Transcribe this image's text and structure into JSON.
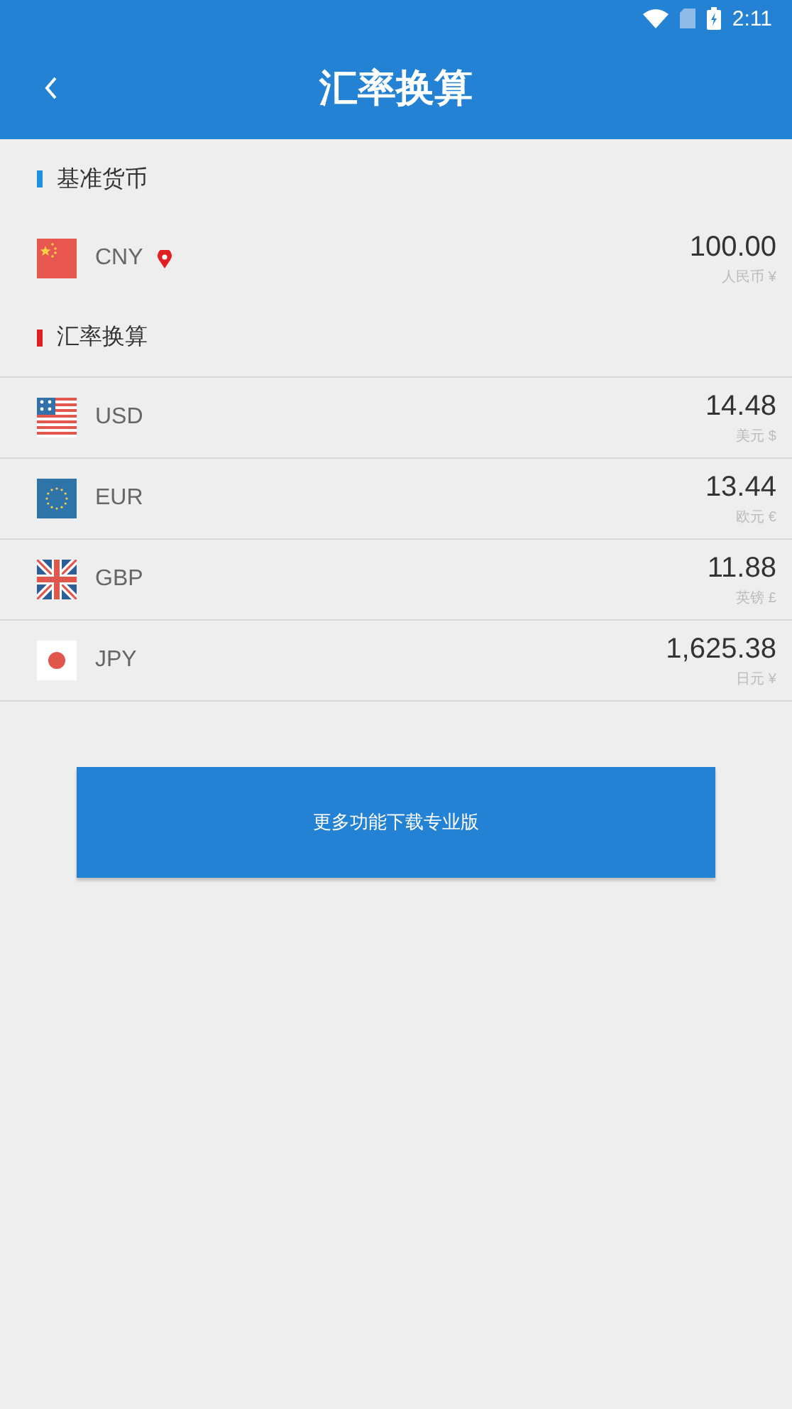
{
  "status_bar": {
    "time": "2:11"
  },
  "app_bar": {
    "title": "汇率换算"
  },
  "base_section": {
    "title": "基准货币",
    "currency": {
      "kind": "cn",
      "code": "CNY",
      "amount": "100.00",
      "name": "人民币 ¥"
    }
  },
  "rates_section": {
    "title": "汇率换算",
    "currencies": [
      {
        "kind": "us",
        "code": "USD",
        "amount": "14.48",
        "name": "美元 $"
      },
      {
        "kind": "eu",
        "code": "EUR",
        "amount": "13.44",
        "name": "欧元 €"
      },
      {
        "kind": "gb",
        "code": "GBP",
        "amount": "11.88",
        "name": "英镑 £"
      },
      {
        "kind": "jp",
        "code": "JPY",
        "amount": "1,625.38",
        "name": "日元 ¥"
      }
    ]
  },
  "pro_button": {
    "label": "更多功能下载专业版"
  }
}
